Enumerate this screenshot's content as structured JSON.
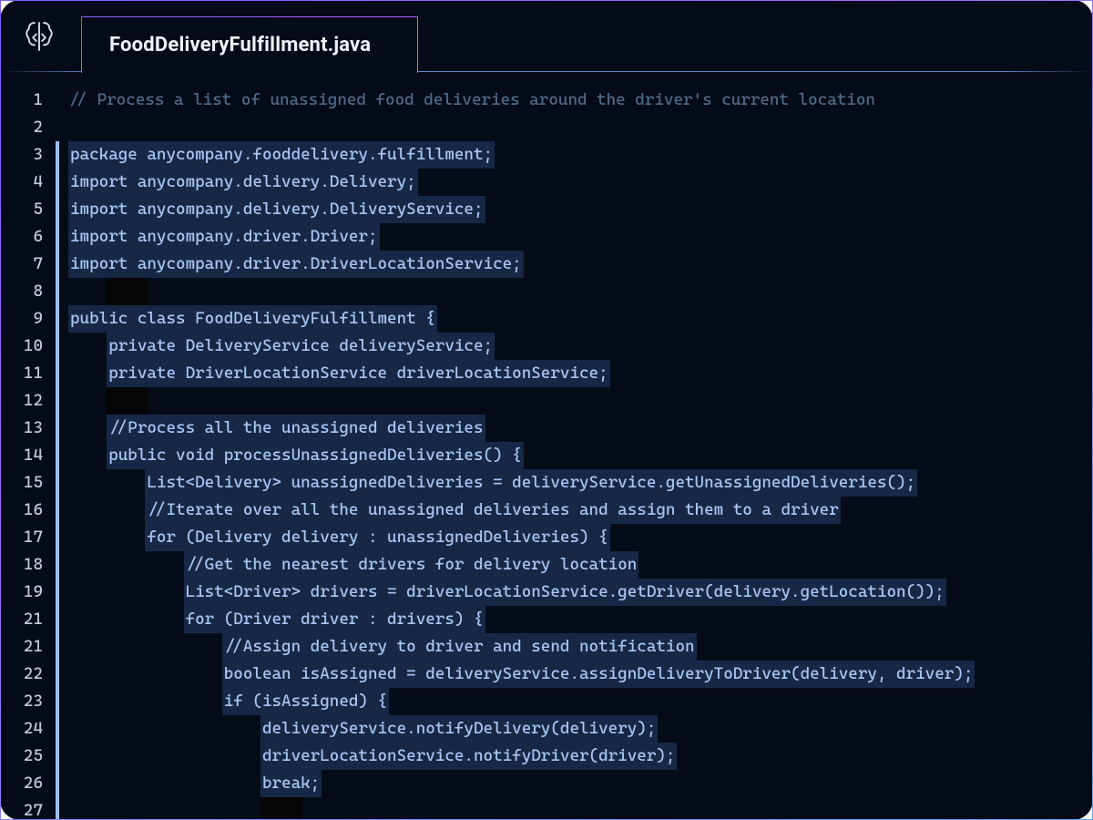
{
  "colors": {
    "bg": "#050b18",
    "highlight_bg": "#162845",
    "dark_bg": "#060606",
    "text": "#a9c6f5",
    "comment": "#4f6a8a",
    "gutter": "#c0cbdc",
    "accent_bar": "#9fbfff"
  },
  "tab": {
    "label": "FoodDeliveryFulfillment.java"
  },
  "icons": {
    "brand": "code-brain-icon"
  },
  "lines": [
    {
      "n": "1",
      "indent": 0,
      "text": "// Process a list of unassigned food deliveries around the driver's current location",
      "comment": true,
      "hl": false
    },
    {
      "n": "2",
      "indent": 0,
      "text": "",
      "hl": false
    },
    {
      "n": "3",
      "indent": 0,
      "text": "package anycompany.fooddelivery.fulfillment;",
      "hl": true
    },
    {
      "n": "4",
      "indent": 0,
      "text": "import anycompany.delivery.Delivery;",
      "hl": true
    },
    {
      "n": "5",
      "indent": 0,
      "text": "import anycompany.delivery.DeliveryService;",
      "hl": true
    },
    {
      "n": "6",
      "indent": 0,
      "text": "import anycompany.driver.Driver;",
      "hl": true
    },
    {
      "n": "7",
      "indent": 0,
      "text": "import anycompany.driver.DriverLocationService;",
      "hl": true
    },
    {
      "n": "8",
      "indent": 1,
      "text": "",
      "hl": true,
      "dark": true
    },
    {
      "n": "9",
      "indent": 0,
      "text": "public class FoodDeliveryFulfillment {",
      "hl": true
    },
    {
      "n": "10",
      "indent": 1,
      "text": "private DeliveryService deliveryService;",
      "hl": true
    },
    {
      "n": "11",
      "indent": 1,
      "text": "private DriverLocationService driverLocationService;",
      "hl": true
    },
    {
      "n": "12",
      "indent": 1,
      "text": "",
      "hl": true,
      "dark": true
    },
    {
      "n": "13",
      "indent": 1,
      "text": "//Process all the unassigned deliveries",
      "hl": true
    },
    {
      "n": "14",
      "indent": 1,
      "text": "public void processUnassignedDeliveries() {",
      "hl": true
    },
    {
      "n": "15",
      "indent": 2,
      "text": "List<Delivery> unassignedDeliveries = deliveryService.getUnassignedDeliveries();",
      "hl": true
    },
    {
      "n": "16",
      "indent": 2,
      "text": "//Iterate over all the unassigned deliveries and assign them to a driver",
      "hl": true
    },
    {
      "n": "17",
      "indent": 2,
      "text": "for (Delivery delivery : unassignedDeliveries) {",
      "hl": true
    },
    {
      "n": "18",
      "indent": 3,
      "text": "//Get the nearest drivers for delivery location",
      "hl": true
    },
    {
      "n": "19",
      "indent": 3,
      "text": "List<Driver> drivers = driverLocationService.getDriver(delivery.getLocation());",
      "hl": true
    },
    {
      "n": "21",
      "indent": 3,
      "text": "for (Driver driver : drivers) {",
      "hl": true
    },
    {
      "n": "21",
      "indent": 4,
      "text": "//Assign delivery to driver and send notification",
      "hl": true
    },
    {
      "n": "22",
      "indent": 4,
      "text": "boolean isAssigned = deliveryService.assignDeliveryToDriver(delivery, driver);",
      "hl": true
    },
    {
      "n": "23",
      "indent": 4,
      "text": "if (isAssigned) {",
      "hl": true
    },
    {
      "n": "24",
      "indent": 5,
      "text": "deliveryService.notifyDelivery(delivery);",
      "hl": true
    },
    {
      "n": "25",
      "indent": 5,
      "text": "driverLocationService.notifyDriver(driver);",
      "hl": true
    },
    {
      "n": "26",
      "indent": 5,
      "text": "break;",
      "hl": true
    },
    {
      "n": "27",
      "indent": 5,
      "text": "",
      "hl": true,
      "dark": true
    }
  ],
  "indent_unit": "    "
}
